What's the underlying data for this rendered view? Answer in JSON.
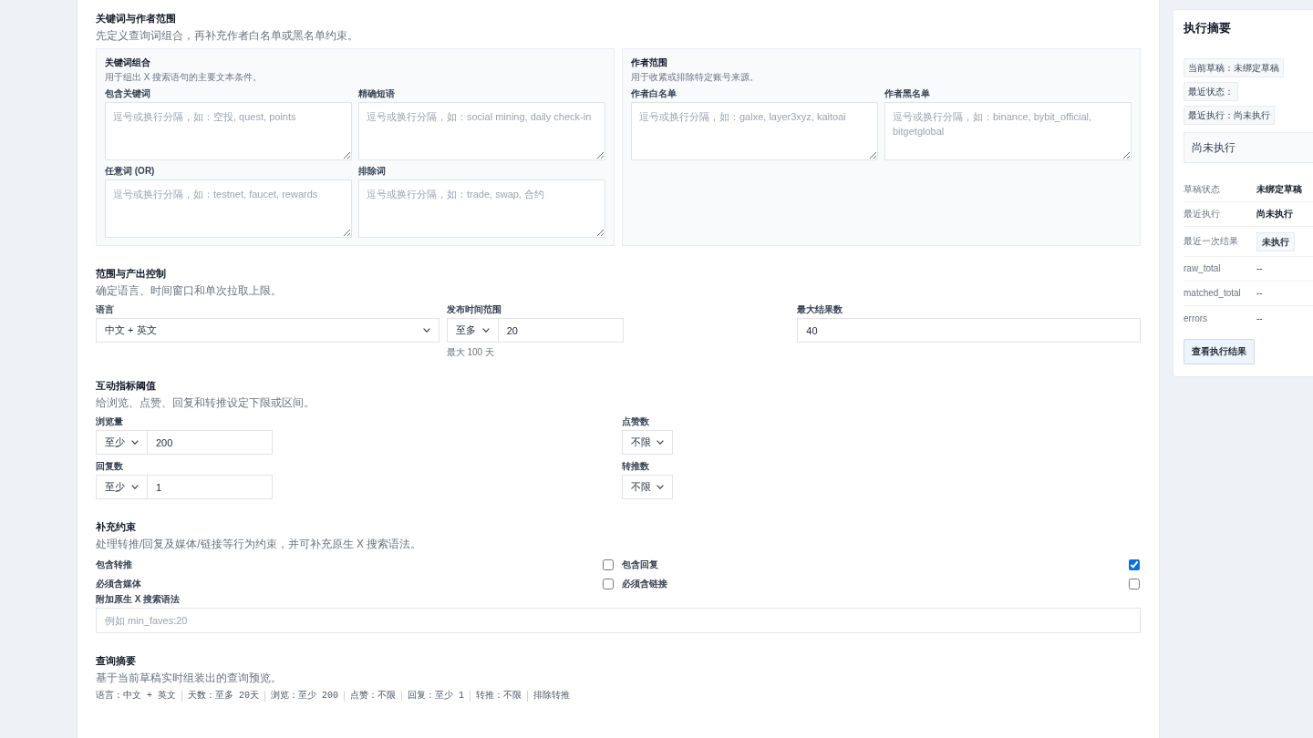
{
  "sections": [
    {
      "kind": "panel_group",
      "title": "关键词与作者范围",
      "description": "先定义查询词组合，再补充作者白名单或黑名单约束。",
      "panels": [
        {
          "title": "关键词组合",
          "description": "用于组出 X 搜索语句的主要文本条件。",
          "fields": [
            {
              "kind": "textarea",
              "label": "包含关键词",
              "placeholder": "逗号或换行分隔，如：空投, quest, points"
            },
            {
              "kind": "textarea",
              "label": "精确短语",
              "placeholder": "逗号或换行分隔，如：social mining, daily check-in"
            },
            {
              "kind": "textarea",
              "label": "任意词 (OR)",
              "placeholder": "逗号或换行分隔，如：testnet, faucet, rewards"
            },
            {
              "kind": "textarea",
              "label": "排除词",
              "placeholder": "逗号或换行分隔，如：trade, swap, 合约"
            }
          ]
        },
        {
          "title": "作者范围",
          "description": "用于收紧或排除特定账号来源。",
          "fields": [
            {
              "kind": "textarea",
              "label": "作者白名单",
              "placeholder": "逗号或换行分隔，如：galxe, layer3xyz, kaitoai"
            },
            {
              "kind": "textarea",
              "label": "作者黑名单",
              "placeholder": "逗号或换行分隔，如：binance, bybit_official, bitgetglobal"
            }
          ]
        }
      ]
    },
    {
      "kind": "control_grid",
      "title": "范围与产出控制",
      "description": "确定语言、时间窗口和单次拉取上限。",
      "fields": [
        {
          "kind": "select",
          "label": "语言",
          "value": "中文 + 英文"
        },
        {
          "kind": "range",
          "label": "发布时间范围",
          "operator": "至多",
          "value": "20",
          "hint": "最大 100 天"
        },
        {
          "kind": "input",
          "label": "最大结果数",
          "value": "40"
        }
      ]
    },
    {
      "kind": "threshold_grid",
      "title": "互动指标阈值",
      "description": "给浏览、点赞、回复和转推设定下限或区间。",
      "fields": [
        {
          "kind": "range",
          "label": "浏览量",
          "operator": "至少",
          "value": "200"
        },
        {
          "kind": "select",
          "label": "点赞数",
          "value": "不限"
        },
        {
          "kind": "range",
          "label": "回复数",
          "operator": "至少",
          "value": "1"
        },
        {
          "kind": "select",
          "label": "转推数",
          "value": "不限"
        }
      ]
    },
    {
      "kind": "constraints",
      "title": "补充约束",
      "description": "处理转推/回复及媒体/链接等行为约束，并可补充原生 X 搜索语法。",
      "options": [
        {
          "label": "包含转推",
          "checked": false
        },
        {
          "label": "包含回复",
          "checked": true
        },
        {
          "label": "必须含媒体",
          "checked": false
        },
        {
          "label": "必须含链接",
          "checked": false
        }
      ],
      "fields": [
        {
          "kind": "input",
          "label": "附加原生 X 搜索语法",
          "placeholder": "例如 min_faves:20"
        }
      ]
    },
    {
      "kind": "preview",
      "title": "查询摘要",
      "description": "基于当前草稿实时组装出的查询预览。",
      "items": [
        "语言：中文 + 英文",
        "天数：至多 20天",
        "浏览：至少 200",
        "点赞：不限",
        "回复：至少 1",
        "转推：不限",
        "排除转推"
      ]
    }
  ],
  "execution_summary": {
    "title": "执行摘要",
    "chips": [
      "当前草稿：未绑定草稿",
      "最近状态：",
      "最近执行：尚未执行"
    ],
    "status_message": "尚未执行",
    "details": [
      {
        "kind": "strong",
        "label": "草稿状态",
        "value": "未绑定草稿"
      },
      {
        "kind": "strong",
        "label": "最近执行",
        "value": "尚未执行"
      },
      {
        "kind": "badge",
        "label": "最近一次结果",
        "value": "未执行"
      },
      {
        "kind": "plain",
        "label": "raw_total",
        "value": "--"
      },
      {
        "kind": "plain",
        "label": "matched_total",
        "value": "--"
      },
      {
        "kind": "plain",
        "label": "errors",
        "value": "--"
      }
    ],
    "action": "查看执行结果"
  }
}
